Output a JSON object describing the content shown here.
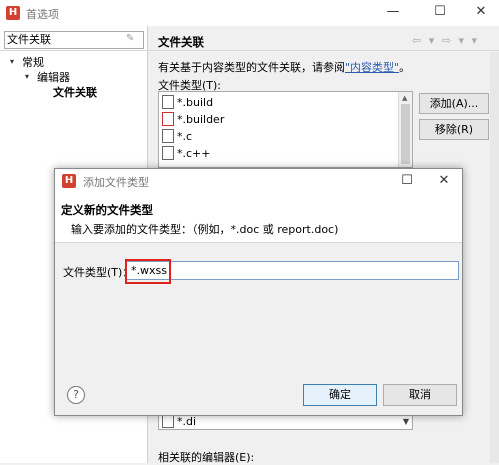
{
  "main_window": {
    "app_icon_letter": "H",
    "title": "首选项",
    "minimize_glyph": "—",
    "maximize_glyph": "☐",
    "close_glyph": "✕"
  },
  "left_pane": {
    "filter_value": "文件关联",
    "tree": [
      {
        "label": "常规",
        "arrow": "▾"
      },
      {
        "label": "编辑器",
        "arrow": "▾"
      },
      {
        "label": "文件关联",
        "arrow": ""
      }
    ]
  },
  "right_pane": {
    "title": "文件关联",
    "nav_glyphs": "⇦ ▾ ⇨ ▾ ▾",
    "description_prefix": "有关基于内容类型的文件关联，请参阅",
    "description_link": "\"内容类型\"",
    "description_suffix": "。",
    "file_types_label": "文件类型(T):",
    "file_types": [
      "*.build",
      "*.builder",
      "*.c",
      "*.c++",
      "*"
    ],
    "add_button": "添加(A)...",
    "remove_button": "移除(R)",
    "combo_value": "*.di",
    "associated_editors_label": "相关联的编辑器(E):"
  },
  "dialog": {
    "app_icon_letter": "H",
    "title": "添加文件类型",
    "maximize_glyph": "☐",
    "close_glyph": "✕",
    "header_title": "定义新的文件类型",
    "header_desc": "输入要添加的文件类型：（例如，*.doc 或 report.doc)",
    "field_label": "文件类型(T)：",
    "field_value": "*.wxss",
    "help_glyph": "?",
    "ok_button": "确定",
    "cancel_button": "取消"
  },
  "colors": {
    "highlight": "#e0231a",
    "link": "#2a5db0",
    "app_icon": "#d2402f"
  }
}
